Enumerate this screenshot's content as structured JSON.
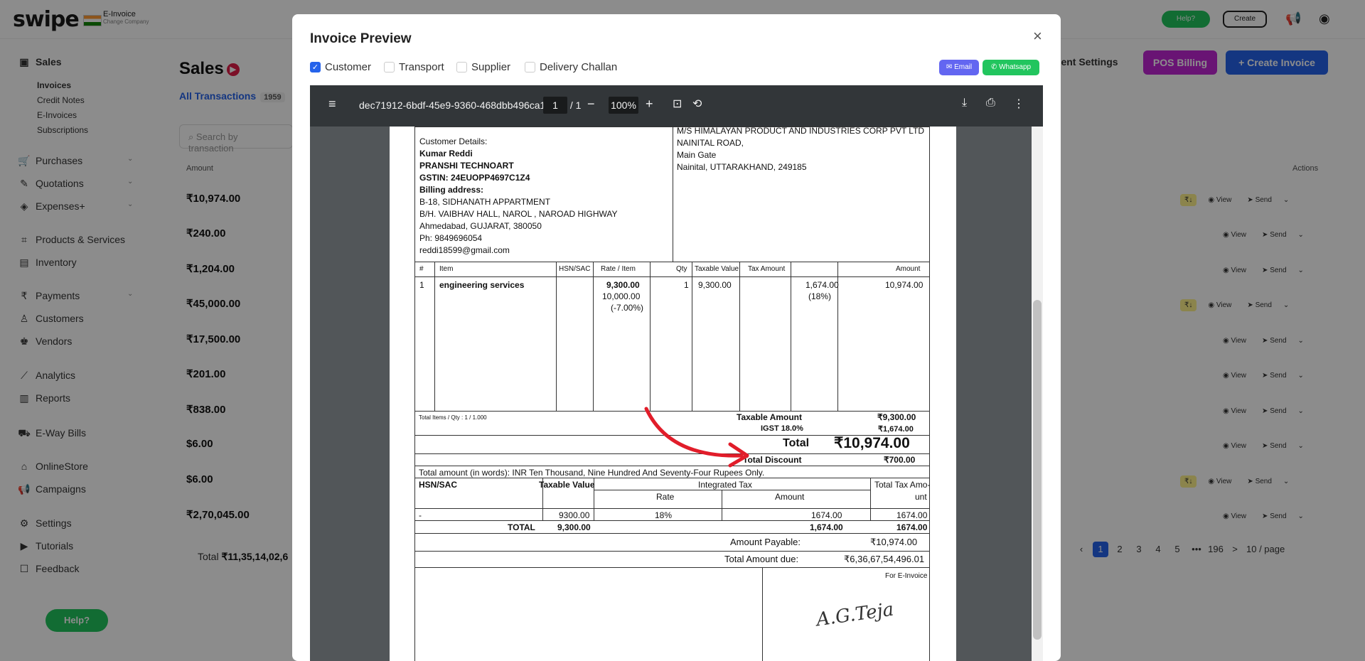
{
  "app": {
    "logo": "swipe",
    "company_name": "E-Invoice",
    "company_sub": "Change Company",
    "help_label": "Help?",
    "create_label": "Create"
  },
  "sidebar": {
    "sales": "Sales",
    "sub": [
      "Invoices",
      "Credit Notes",
      "E-Invoices",
      "Subscriptions"
    ],
    "items": [
      "Purchases",
      "Quotations",
      "Expenses+",
      "Products & Services",
      "Inventory",
      "Payments",
      "Customers",
      "Vendors",
      "Analytics",
      "Reports",
      "E-Way Bills",
      "OnlineStore",
      "Campaigns",
      "Settings",
      "Tutorials",
      "Feedback"
    ],
    "help_float": "Help?"
  },
  "main": {
    "title": "Sales",
    "tab_all": "All Transactions",
    "tab_count": "1959",
    "search_placeholder": "Search by transaction",
    "doc_settings": "ment Settings",
    "pos_billing": "POS Billing",
    "create_invoice": "+ Create Invoice",
    "col_amount": "Amount",
    "col_actions": "Actions",
    "amounts": [
      "₹10,974.00",
      "₹240.00",
      "₹1,204.00",
      "₹45,000.00",
      "₹17,500.00",
      "₹201.00",
      "₹838.00",
      "$6.00",
      "$6.00",
      "₹2,70,045.00"
    ],
    "view_label": "View",
    "send_label": "Send",
    "total_prefix": "Total",
    "total_value": "₹11,35,14,02,6",
    "pager": [
      "1",
      "2",
      "3",
      "4",
      "5",
      "•••",
      "196",
      ">",
      "10 / page"
    ]
  },
  "modal": {
    "title": "Invoice Preview",
    "close": "×",
    "options": [
      "Customer",
      "Transport",
      "Supplier",
      "Delivery Challan"
    ],
    "email": "Email",
    "whatsapp": "Whatsapp",
    "pdf_name": "dec71912-6bdf-45e9-9360-468dbb496ca1",
    "page_current": "1",
    "page_total": "/ 1",
    "zoom": "100%"
  },
  "invoice": {
    "customer_heading": "Customer Details:",
    "customer_name": "Kumar Reddi",
    "customer_company": "PRANSHI TECHNOART",
    "gstin": "GSTIN: 24EUOPP4697C1Z4",
    "billing_heading": "Billing address:",
    "address1": "B-18, SIDHANATH APPARTMENT",
    "address2": "B/H. VAIBHAV HALL, NAROL , NAROAD HIGHWAY",
    "address3": "Ahmedabad, GUJARAT, 380050",
    "phone": "Ph: 9849696054",
    "email": "reddi18599@gmail.com",
    "supplier1": "M/S HIMALAYAN PRODUCT AND INDUSTRIES CORP PVT LTD",
    "supplier2": "NAINITAL ROAD,",
    "supplier3": "Main Gate",
    "supplier4": "Nainital, UTTARAKHAND, 249185",
    "headers": [
      "#",
      "Item",
      "HSN/SAC",
      "Rate / Item",
      "Qty",
      "Taxable Value",
      "Tax Amount",
      "Amount"
    ],
    "item_no": "1",
    "item_name": "engineering services",
    "rate": "9,300.00",
    "rate_orig": "10,000.00",
    "rate_disc": "(-7.00%)",
    "qty": "1",
    "taxable": "9,300.00",
    "tax_amt": "1,674.00",
    "tax_pct": "(18%)",
    "amount": "10,974.00",
    "total_items": "Total Items / Qty : 1 / 1.000",
    "taxable_amount_label": "Taxable Amount",
    "taxable_amount": "₹9,300.00",
    "igst_label": "IGST 18.0%",
    "igst": "₹1,674.00",
    "total_label": "Total",
    "total": "₹10,974.00",
    "discount_label": "Total Discount",
    "discount": "₹700.00",
    "words": "Total amount (in words): INR Ten Thousand, Nine Hundred And Seventy-Four Rupees Only.",
    "tax_headers": [
      "HSN/SAC",
      "Taxable Value",
      "Integrated Tax",
      "Total Tax Amo-",
      "unt",
      "Rate",
      "Amount"
    ],
    "tax_row": [
      "-",
      "9300.00",
      "18%",
      "1674.00",
      "1674.00"
    ],
    "tax_total": [
      "TOTAL",
      "9,300.00",
      "1,674.00",
      "1674.00"
    ],
    "payable_label": "Amount Payable:",
    "payable": "₹10,974.00",
    "due_label": "Total Amount due:",
    "due": "₹6,36,67,54,496.01",
    "for_label": "For E-Invoice",
    "signature": "A.G.Teja"
  }
}
